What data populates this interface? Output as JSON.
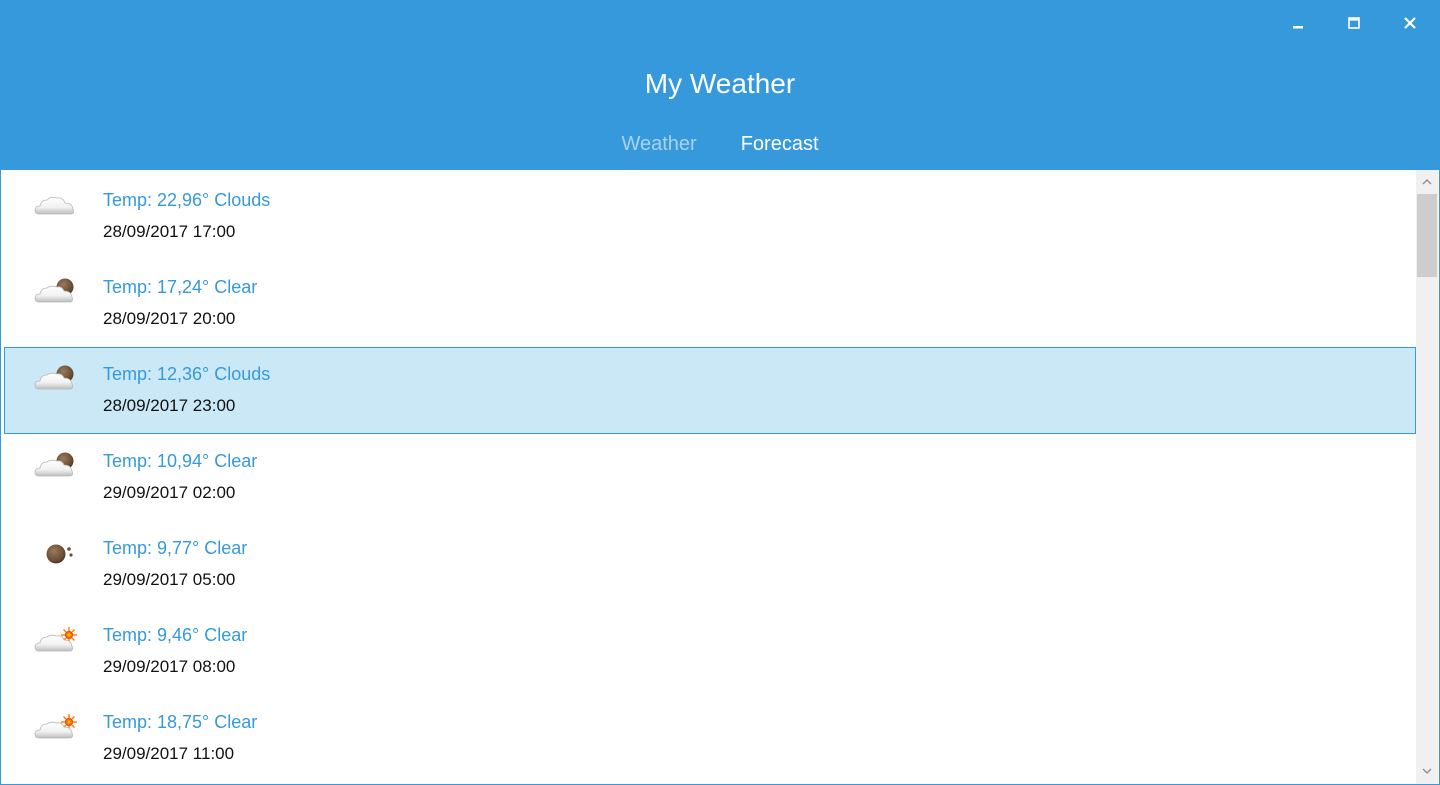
{
  "window": {
    "title": "My Weather",
    "controls": {
      "minimize_icon": "minimize-icon",
      "maximize_icon": "maximize-icon",
      "close_icon": "close-icon"
    }
  },
  "tabs": [
    {
      "label": "Weather",
      "active": false
    },
    {
      "label": "Forecast",
      "active": true
    }
  ],
  "colors": {
    "accent": "#3599DC",
    "selected_row": "#CBE8F6",
    "inactive_tab": "#A9D2F1",
    "temp_text": "#3599DC",
    "date_text": "#111111"
  },
  "forecast": [
    {
      "temp": "Temp: 22,96° Clouds",
      "date": "28/09/2017 17:00",
      "icon": "cloud-icon",
      "selected": false
    },
    {
      "temp": "Temp: 17,24° Clear",
      "date": "28/09/2017 20:00",
      "icon": "cloud-night-icon",
      "selected": false
    },
    {
      "temp": "Temp: 12,36° Clouds",
      "date": "28/09/2017 23:00",
      "icon": "cloud-night-icon",
      "selected": true
    },
    {
      "temp": "Temp: 10,94° Clear",
      "date": "29/09/2017 02:00",
      "icon": "cloud-night-icon",
      "selected": false
    },
    {
      "temp": "Temp: 9,77° Clear",
      "date": "29/09/2017 05:00",
      "icon": "moon-icon",
      "selected": false
    },
    {
      "temp": "Temp: 9,46° Clear",
      "date": "29/09/2017 08:00",
      "icon": "cloud-sun-icon",
      "selected": false
    },
    {
      "temp": "Temp: 18,75° Clear",
      "date": "29/09/2017 11:00",
      "icon": "cloud-sun-icon",
      "selected": false
    }
  ],
  "scrollbar": {
    "up_icon": "scroll-up-icon",
    "down_icon": "scroll-down-icon"
  }
}
